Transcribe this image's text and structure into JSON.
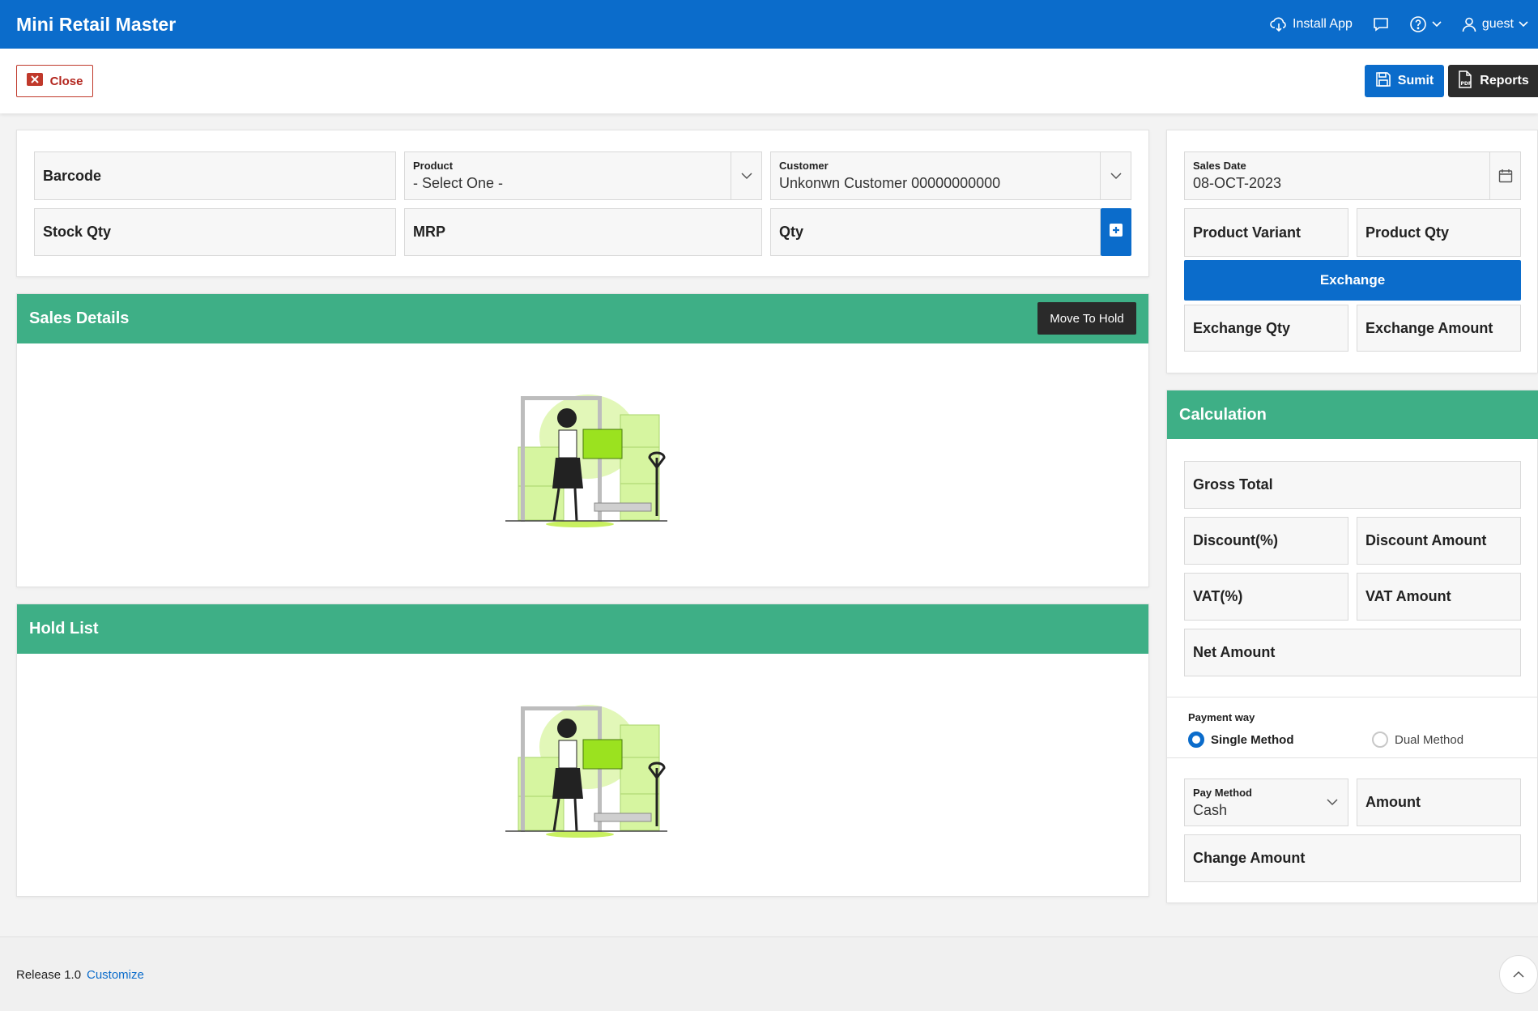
{
  "app": {
    "title": "Mini Retail Master"
  },
  "header": {
    "install_label": "Install App",
    "user_label": "guest",
    "icons": [
      "cloud-download-icon",
      "chat-icon",
      "help-icon",
      "user-icon"
    ]
  },
  "toolbar": {
    "close_label": "Close",
    "submit_label": "Sumit",
    "reports_label": "Reports"
  },
  "entry": {
    "barcode_label": "Barcode",
    "product_label": "Product",
    "product_value": "- Select One -",
    "customer_label": "Customer",
    "customer_value": "Unkonwn Customer 00000000000",
    "stock_qty_label": "Stock Qty",
    "mrp_label": "MRP",
    "qty_label": "Qty"
  },
  "sales_details": {
    "title": "Sales Details",
    "hold_button": "Move To Hold"
  },
  "hold_list": {
    "title": "Hold List"
  },
  "right_top": {
    "sales_date_label": "Sales Date",
    "sales_date_value": "08-OCT-2023",
    "product_variant_label": "Product Variant",
    "product_qty_label": "Product Qty",
    "exchange_button": "Exchange",
    "exchange_qty_label": "Exchange Qty",
    "exchange_amount_label": "Exchange Amount"
  },
  "calculation": {
    "title": "Calculation",
    "gross_total_label": "Gross Total",
    "discount_pct_label": "Discount(%)",
    "discount_amount_label": "Discount Amount",
    "vat_pct_label": "VAT(%)",
    "vat_amount_label": "VAT Amount",
    "net_amount_label": "Net Amount",
    "payment_way_label": "Payment way",
    "single_method_label": "Single Method",
    "dual_method_label": "Dual Method",
    "selected_payment_way": "Single Method",
    "pay_method_label": "Pay Method",
    "pay_method_value": "Cash",
    "amount_label": "Amount",
    "change_amount_label": "Change Amount"
  },
  "footer": {
    "release": "Release 1.0",
    "customize": "Customize"
  },
  "colors": {
    "primary": "#0B6CCB",
    "green_header": "#3EAF86",
    "close_red": "#b3261e",
    "dark_button": "#2c2c2c"
  }
}
